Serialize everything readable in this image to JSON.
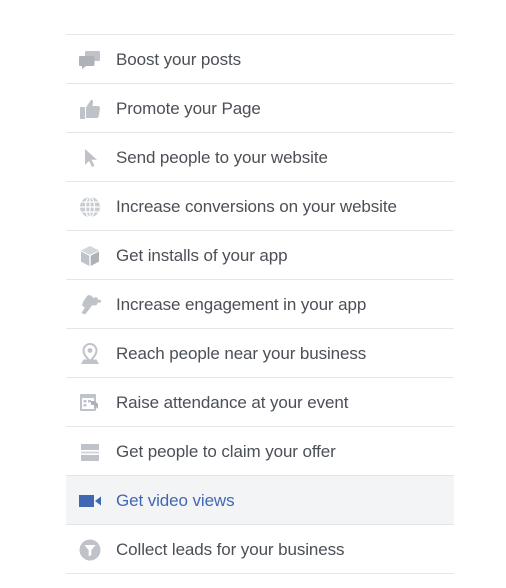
{
  "colors": {
    "icon_gray": "#bfc3c9",
    "label_gray": "#4b4f56",
    "selected_blue": "#4267b2",
    "selected_bg": "#f3f4f6",
    "divider": "#e5e6e9"
  },
  "objectives": [
    {
      "label": "Boost your posts",
      "icon": "speech-bubbles-icon",
      "selected": false
    },
    {
      "label": "Promote your Page",
      "icon": "thumbs-up-icon",
      "selected": false
    },
    {
      "label": "Send people to your website",
      "icon": "cursor-arrow-icon",
      "selected": false
    },
    {
      "label": "Increase conversions on your website",
      "icon": "globe-icon",
      "selected": false
    },
    {
      "label": "Get installs of your app",
      "icon": "box-icon",
      "selected": false
    },
    {
      "label": "Increase engagement in your app",
      "icon": "hand-tap-icon",
      "selected": false
    },
    {
      "label": "Reach people near your business",
      "icon": "location-pin-icon",
      "selected": false
    },
    {
      "label": "Raise attendance at your event",
      "icon": "calendar-icon",
      "selected": false
    },
    {
      "label": "Get people to claim your offer",
      "icon": "ticket-icon",
      "selected": false
    },
    {
      "label": "Get video views",
      "icon": "video-camera-icon",
      "selected": true
    },
    {
      "label": "Collect leads for your business",
      "icon": "funnel-icon",
      "selected": false
    }
  ]
}
